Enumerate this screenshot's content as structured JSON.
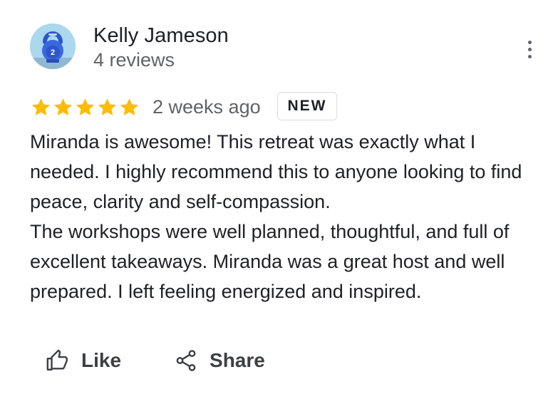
{
  "review": {
    "author_name": "Kelly Jameson",
    "author_review_count": "4 reviews",
    "avatar_icon": "kettlebell-avatar-icon",
    "rating": 5,
    "rating_max": 5,
    "star_color": "#fbbc04",
    "date": "2 weeks ago",
    "badge": "NEW",
    "text_paragraphs": [
      "Miranda is awesome! This retreat was exactly what I needed. I highly recommend this to anyone looking to find peace, clarity and self-compassion.",
      "The workshops were well planned, thoughtful, and full of excellent takeaways. Miranda was a great host and well prepared. I left feeling energized and inspired."
    ]
  },
  "actions": {
    "like_label": "Like",
    "like_icon": "thumbs-up-icon",
    "share_label": "Share",
    "share_icon": "share-icon"
  },
  "menu": {
    "icon": "more-vertical-icon"
  }
}
